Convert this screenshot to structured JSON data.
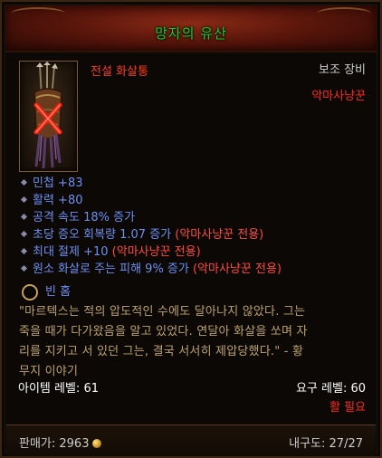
{
  "tooltip": {
    "title": "망자의 유산",
    "item_type": "전설 화살통",
    "slot": "보조 장비",
    "class_requirement": "악마사냥꾼",
    "stats": [
      {
        "text": "민첩 +83",
        "tag": ""
      },
      {
        "text": "활력 +80",
        "tag": ""
      },
      {
        "text": "공격 속도 18% 증가",
        "tag": ""
      },
      {
        "text": "초당 증오 회복량 1.07 증가 ",
        "tag": "(악마사냥꾼 전용)"
      },
      {
        "text": "최대 절제 +10 ",
        "tag": "(악마사냥꾼 전용)"
      },
      {
        "text": "원소 화살로 주는 피해 9% 증가 ",
        "tag": "(악마사냥꾼 전용)"
      }
    ],
    "socket_label": "빈 홈",
    "flavor_lines": [
      "\"마르텍스는 적의 압도적인 수에도 달아나지 않았다. 그는",
      "죽을 때가 다가왔음을 알고 있었다. 연달아 화살을 쏘며 자",
      "리를 지키고 서 있던 그는, 결국 서서히 제압당했다.\" - 황",
      "무지 이야기"
    ],
    "item_level": "아이템 레벨: 61",
    "required_level": "요구 레벨: 60",
    "required_weapon": "활 필요",
    "price": "판매가: 2963",
    "durability": "내구도: 27/27"
  },
  "colors": {
    "title": "#0dd32a",
    "legendary": "#ff3a1a",
    "stat": "#6f8ff0",
    "restriction": "#ff4a3a",
    "flavor": "#bda36a"
  },
  "icons": {
    "item": "quiver-icon",
    "unusable": "red-x-icon",
    "socket": "socket-ring-icon",
    "gold": "gold-coin-icon"
  }
}
